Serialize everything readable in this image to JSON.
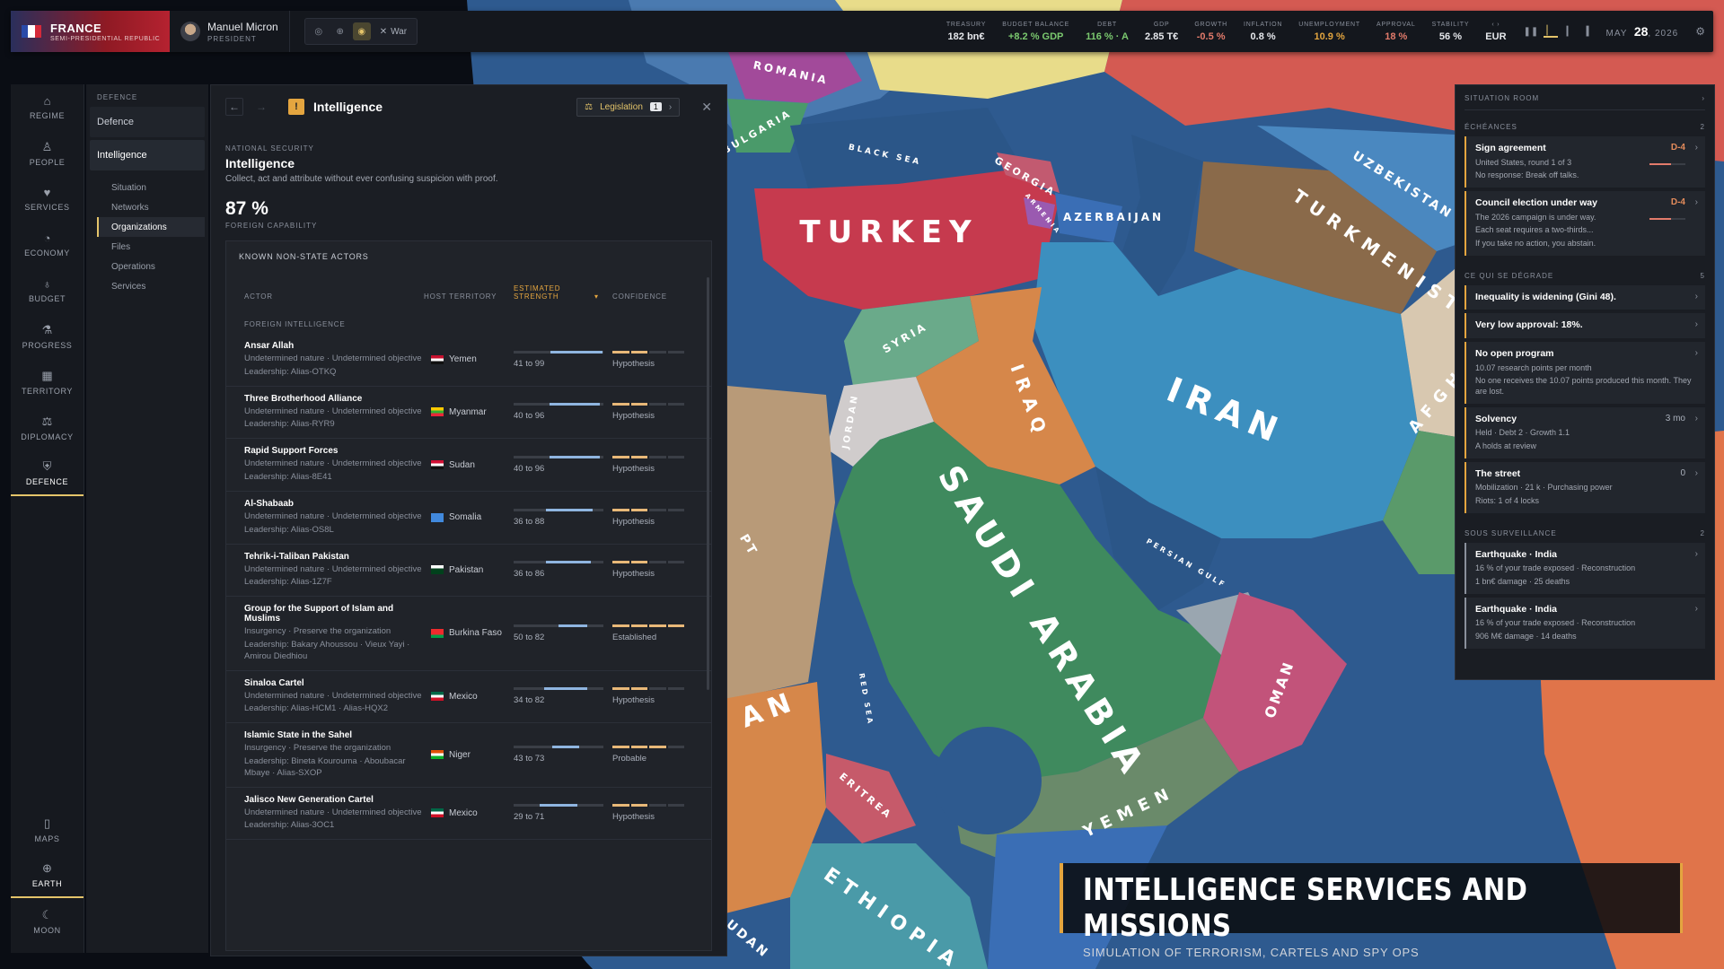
{
  "topbar": {
    "nation": "FRANCE",
    "government": "SEMI-PRESIDENTIAL REPUBLIC",
    "leader_name": "Manuel Micron",
    "leader_role": "PRESIDENT",
    "war_label": "War",
    "stats": [
      {
        "label": "TREASURY",
        "value": "182 bn€",
        "tone": ""
      },
      {
        "label": "BUDGET BALANCE",
        "value": "+8.2 % GDP",
        "tone": "pos"
      },
      {
        "label": "DEBT",
        "value": "116 % · A",
        "tone": "pos"
      },
      {
        "label": "GDP",
        "value": "2.85 T€",
        "tone": ""
      },
      {
        "label": "GROWTH",
        "value": "-0.5 %",
        "tone": "neg"
      },
      {
        "label": "INFLATION",
        "value": "0.8 %",
        "tone": ""
      },
      {
        "label": "UNEMPLOYMENT",
        "value": "10.9 %",
        "tone": "warn"
      },
      {
        "label": "APPROVAL",
        "value": "18 %",
        "tone": "neg"
      },
      {
        "label": "STABILITY",
        "value": "56 %",
        "tone": ""
      }
    ],
    "currency": "EUR",
    "month": "MAY",
    "day": "28",
    "year": ", 2026"
  },
  "leftnav": [
    {
      "label": "REGIME",
      "icon": "landmark-icon",
      "glyph": "⌂"
    },
    {
      "label": "PEOPLE",
      "icon": "person-icon",
      "glyph": "♙"
    },
    {
      "label": "SERVICES",
      "icon": "heart-icon",
      "glyph": "♥"
    },
    {
      "label": "ECONOMY",
      "icon": "pie-chart-icon",
      "glyph": "◔"
    },
    {
      "label": "BUDGET",
      "icon": "money-bag-icon",
      "glyph": "♁"
    },
    {
      "label": "PROGRESS",
      "icon": "flask-icon",
      "glyph": "⚗"
    },
    {
      "label": "TERRITORY",
      "icon": "map-grid-icon",
      "glyph": "▦"
    },
    {
      "label": "DIPLOMACY",
      "icon": "handshake-icon",
      "glyph": "⚖"
    },
    {
      "label": "DEFENCE",
      "icon": "shield-icon",
      "glyph": "⛨"
    }
  ],
  "leftnav_bottom": [
    {
      "label": "MAPS",
      "icon": "map-icon",
      "glyph": "▯"
    },
    {
      "label": "EARTH",
      "icon": "globe-icon",
      "glyph": "⊕"
    },
    {
      "label": "MOON",
      "icon": "moon-icon",
      "glyph": "☾"
    }
  ],
  "subnav": {
    "title": "DEFENCE",
    "group1": "Defence",
    "group2": "Intelligence",
    "items": [
      "Situation",
      "Networks",
      "Organizations",
      "Files",
      "Operations",
      "Services"
    ]
  },
  "panel": {
    "title": "Intelligence",
    "legislation_label": "Legislation",
    "legislation_count": "1",
    "eyebrow": "NATIONAL SECURITY",
    "heading": "Intelligence",
    "description": "Collect, act and attribute without ever confusing suspicion with proof.",
    "capability_value": "87 %",
    "capability_label": "FOREIGN CAPABILITY",
    "table_title": "KNOWN NON-STATE ACTORS",
    "col_actor": "ACTOR",
    "col_host": "HOST TERRITORY",
    "col_strength": "ESTIMATED STRENGTH",
    "col_confidence": "CONFIDENCE",
    "section": "FOREIGN INTELLIGENCE",
    "rows": [
      {
        "name": "Ansar Allah",
        "nature": "Undetermined nature · Undetermined objective",
        "leadership": "Leadership: Alias-OTKQ",
        "host": "Yemen",
        "strength": "41 to 99",
        "lo": 41,
        "hi": 99,
        "confidence": "Hypothesis",
        "conf_level": 2
      },
      {
        "name": "Three Brotherhood Alliance",
        "nature": "Undetermined nature · Undetermined objective",
        "leadership": "Leadership: Alias-RYR9",
        "host": "Myanmar",
        "strength": "40 to 96",
        "lo": 40,
        "hi": 96,
        "confidence": "Hypothesis",
        "conf_level": 2
      },
      {
        "name": "Rapid Support Forces",
        "nature": "Undetermined nature · Undetermined objective",
        "leadership": "Leadership: Alias-8E41",
        "host": "Sudan",
        "strength": "40 to 96",
        "lo": 40,
        "hi": 96,
        "confidence": "Hypothesis",
        "conf_level": 2
      },
      {
        "name": "Al-Shabaab",
        "nature": "Undetermined nature · Undetermined objective",
        "leadership": "Leadership: Alias-OS8L",
        "host": "Somalia",
        "strength": "36 to 88",
        "lo": 36,
        "hi": 88,
        "confidence": "Hypothesis",
        "conf_level": 2
      },
      {
        "name": "Tehrik-i-Taliban Pakistan",
        "nature": "Undetermined nature · Undetermined objective",
        "leadership": "Leadership: Alias-1Z7F",
        "host": "Pakistan",
        "strength": "36 to 86",
        "lo": 36,
        "hi": 86,
        "confidence": "Hypothesis",
        "conf_level": 2
      },
      {
        "name": "Group for the Support of Islam and Muslims",
        "nature": "Insurgency · Preserve the organization",
        "leadership": "Leadership: Bakary Ahoussou · Vieux Yayi · Amirou Diedhiou",
        "host": "Burkina Faso",
        "strength": "50 to 82",
        "lo": 50,
        "hi": 82,
        "confidence": "Established",
        "conf_level": 4
      },
      {
        "name": "Sinaloa Cartel",
        "nature": "Undetermined nature · Undetermined objective",
        "leadership": "Leadership: Alias-HCM1 · Alias-HQX2",
        "host": "Mexico",
        "strength": "34 to 82",
        "lo": 34,
        "hi": 82,
        "confidence": "Hypothesis",
        "conf_level": 2
      },
      {
        "name": "Islamic State in the Sahel",
        "nature": "Insurgency · Preserve the organization",
        "leadership": "Leadership: Bineta Kourouma · Aboubacar Mbaye · Alias-SXOP",
        "host": "Niger",
        "strength": "43 to 73",
        "lo": 43,
        "hi": 73,
        "confidence": "Probable",
        "conf_level": 3
      },
      {
        "name": "Jalisco New Generation Cartel",
        "nature": "Undetermined nature · Undetermined objective",
        "leadership": "Leadership: Alias-3OC1",
        "host": "Mexico",
        "strength": "29 to 71",
        "lo": 29,
        "hi": 71,
        "confidence": "Hypothesis",
        "conf_level": 2
      }
    ]
  },
  "situation": {
    "title": "SITUATION ROOM",
    "sec1": "ÉCHÉANCES",
    "sec1_count": "2",
    "sec2": "CE QUI SE DÉGRADE",
    "sec2_count": "5",
    "sec3": "SOUS SURVEILLANCE",
    "sec3_count": "2",
    "deadlines": [
      {
        "title": "Sign agreement",
        "lines": [
          "United States, round 1 of 3",
          "No response: Break off talks."
        ],
        "badge": "D-4",
        "progress": 0.6
      },
      {
        "title": "Council election under way",
        "lines": [
          "The 2026 campaign is under way.",
          "Each seat requires a two-thirds...",
          "If you take no action, you abstain."
        ],
        "badge": "D-4",
        "progress": 0.6
      }
    ],
    "degrading": [
      {
        "title": "Inequality is widening (Gini 48).",
        "lines": [],
        "badge": ""
      },
      {
        "title": "Very low approval: 18%.",
        "lines": [],
        "badge": ""
      },
      {
        "title": "No open program",
        "lines": [
          "10.07 research points per month",
          "No one receives the 10.07 points produced this month. They are lost."
        ],
        "badge": ""
      },
      {
        "title": "Solvency",
        "lines": [
          "Held · Debt 2 · Growth 1.1",
          "A holds at review"
        ],
        "badge": "3 mo"
      },
      {
        "title": "The street",
        "lines": [
          "Mobilization · 21 k · Purchasing power",
          "Riots: 1 of 4 locks"
        ],
        "badge": "0"
      }
    ],
    "watch": [
      {
        "title": "Earthquake · India",
        "lines": [
          "16 % of your trade exposed · Reconstruction",
          "1 bn€ damage · 25 deaths"
        ]
      },
      {
        "title": "Earthquake · India",
        "lines": [
          "16 % of your trade exposed · Reconstruction",
          "906 M€ damage · 14 deaths"
        ]
      }
    ]
  },
  "map_labels": [
    "TURKEY",
    "IRAN",
    "IRAQ",
    "SYRIA",
    "SAUDI ARABIA",
    "YEMEN",
    "OMAN",
    "TURKMENISTAN",
    "UZBEKISTAN",
    "AZERBAIJAN",
    "GEORGIA",
    "ROMANIA",
    "BULGARIA",
    "JORDAN",
    "ERITREA",
    "ETHIOPIA",
    "ARMENIA",
    "BLACK SEA",
    "PERSIAN GULF",
    "RED SEA",
    "AN",
    "PT",
    "AFGH",
    "UDAN"
  ],
  "banner": {
    "title": "INTELLIGENCE SERVICES AND MISSIONS",
    "subtitle": "SIMULATION OF TERRORISM, CARTELS AND SPY OPS"
  },
  "colors": {
    "accent": "#e4a53f",
    "sea": "#2f5a8e",
    "turkey": "#c63a4e",
    "iran": "#3c8fbf",
    "saudi": "#3f8a5e",
    "iraq": "#d6874a",
    "oman": "#c2537a"
  }
}
